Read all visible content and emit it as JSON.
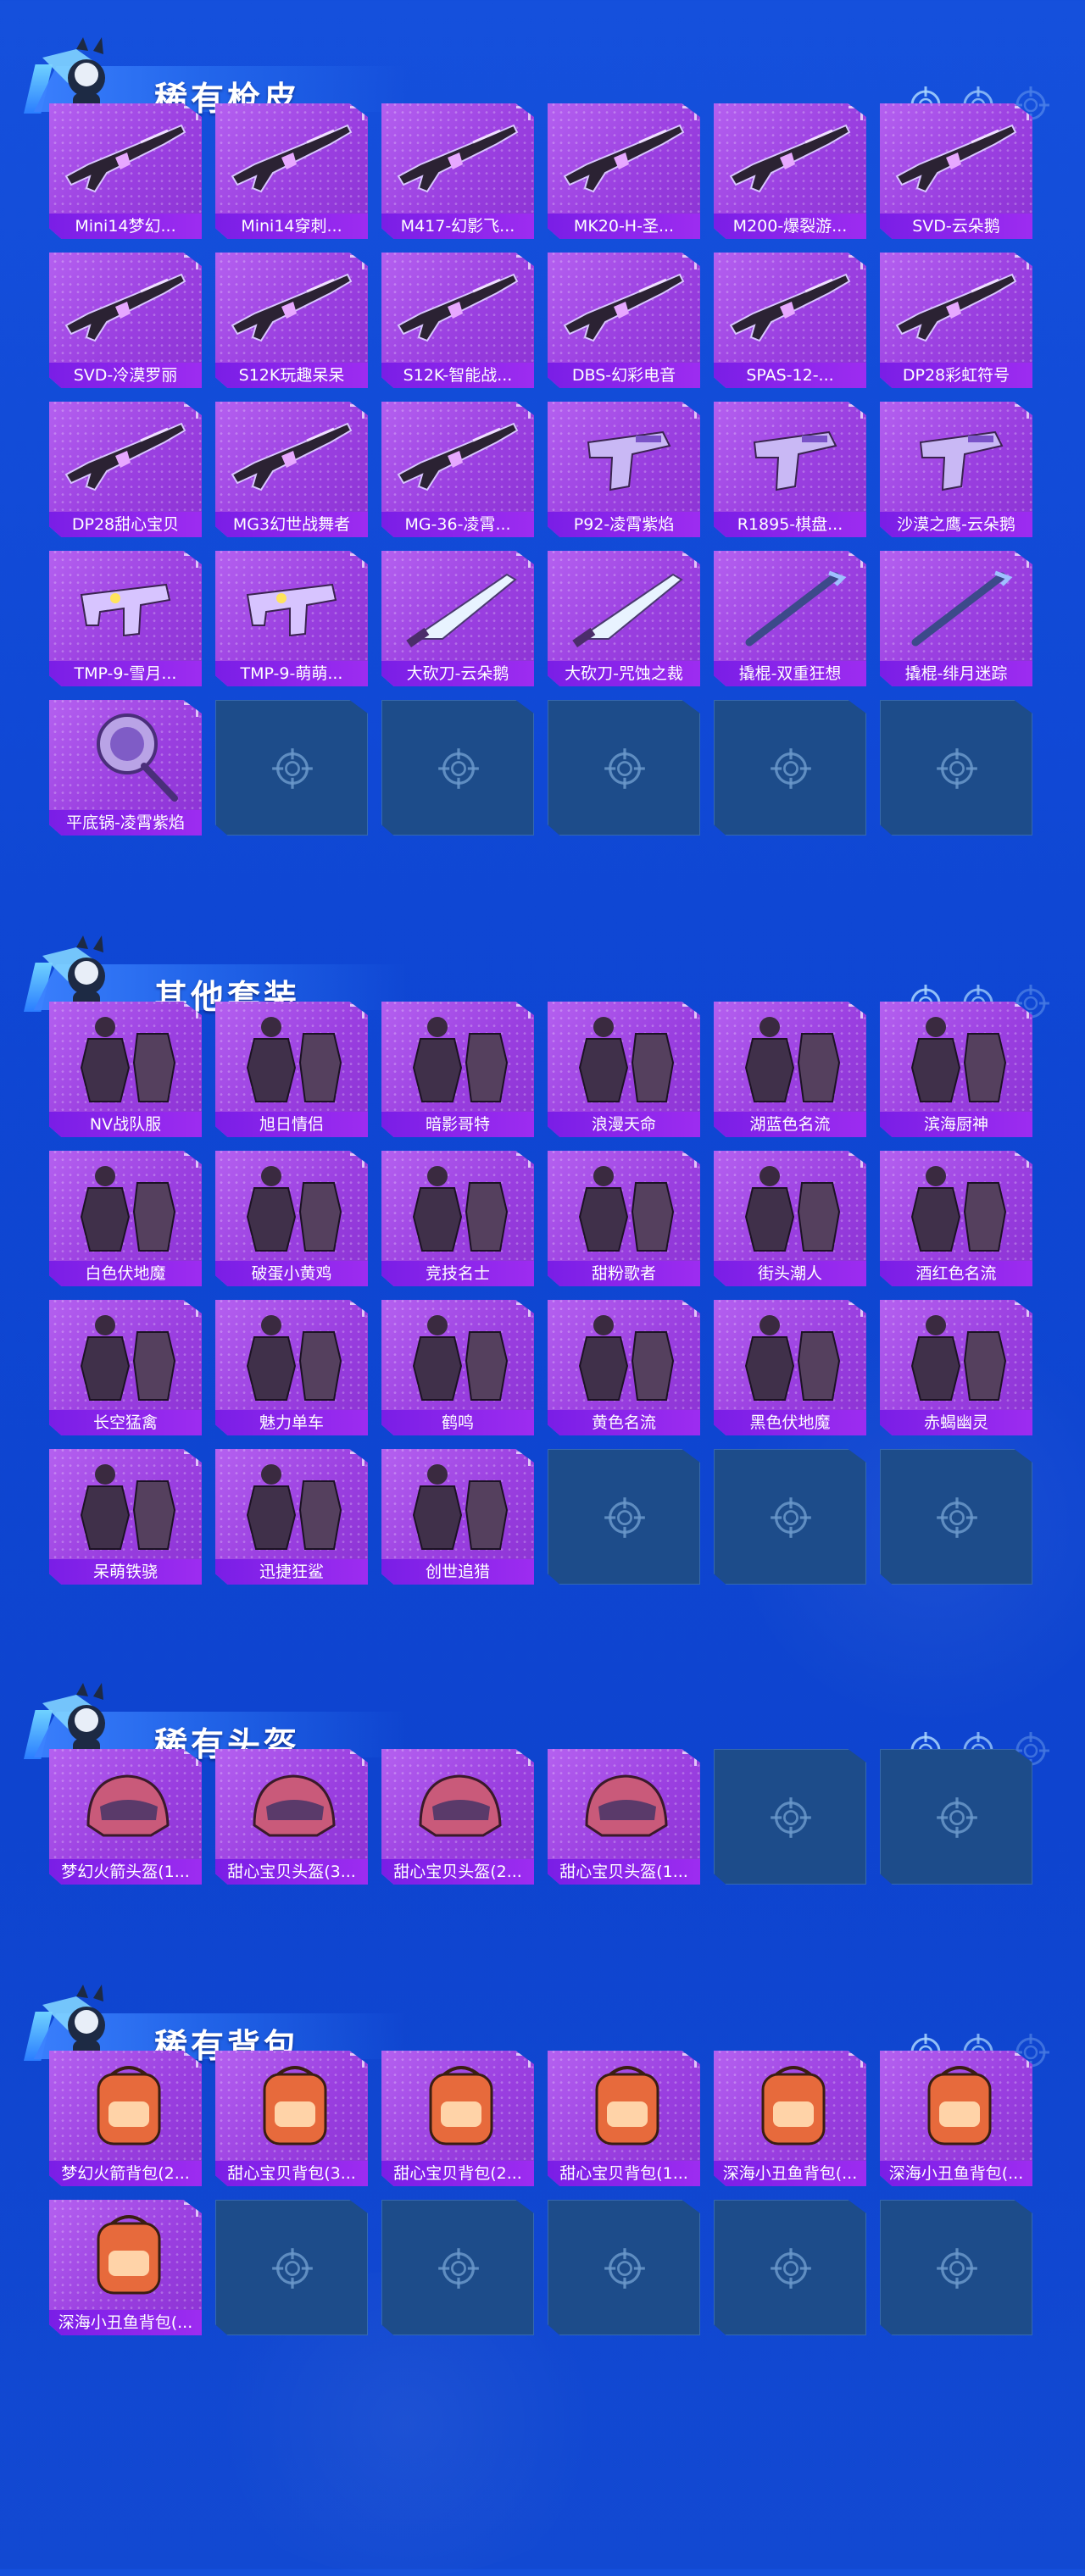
{
  "sections": [
    {
      "title": "稀有枪皮",
      "items": [
        {
          "label": "Mini14梦幻...",
          "art": "rifle"
        },
        {
          "label": "Mini14穿刺...",
          "art": "rifle"
        },
        {
          "label": "M417-幻影飞...",
          "art": "rifle"
        },
        {
          "label": "MK20-H-圣...",
          "art": "rifle"
        },
        {
          "label": "M200-爆裂游...",
          "art": "rifle"
        },
        {
          "label": "SVD-云朵鹅",
          "art": "rifle"
        },
        {
          "label": "SVD-冷漠罗丽",
          "art": "rifle"
        },
        {
          "label": "S12K玩趣呆呆",
          "art": "rifle"
        },
        {
          "label": "S12K-智能战...",
          "art": "rifle"
        },
        {
          "label": "DBS-幻彩电音",
          "art": "rifle"
        },
        {
          "label": "SPAS-12-...",
          "art": "rifle"
        },
        {
          "label": "DP28彩虹符号",
          "art": "rifle"
        },
        {
          "label": "DP28甜心宝贝",
          "art": "rifle"
        },
        {
          "label": "MG3幻世战舞者",
          "art": "rifle"
        },
        {
          "label": "MG-36-凌霄...",
          "art": "rifle"
        },
        {
          "label": "P92-凌霄紫焰",
          "art": "pistol"
        },
        {
          "label": "R1895-棋盘...",
          "art": "pistol"
        },
        {
          "label": "沙漠之鹰-云朵鹅",
          "art": "pistol"
        },
        {
          "label": "TMP-9-雪月...",
          "art": "smg"
        },
        {
          "label": "TMP-9-萌萌...",
          "art": "smg"
        },
        {
          "label": "大砍刀-云朵鹅",
          "art": "blade"
        },
        {
          "label": "大砍刀-咒蚀之裁",
          "art": "blade"
        },
        {
          "label": "撬棍-双重狂想",
          "art": "bar"
        },
        {
          "label": "撬棍-绯月迷踪",
          "art": "bar"
        },
        {
          "label": "平底锅-凌霄紫焰",
          "art": "pan"
        }
      ],
      "empty_slots": 5
    },
    {
      "title": "其他套装",
      "items": [
        {
          "label": "NV战队服",
          "art": "suit"
        },
        {
          "label": "旭日情侣",
          "art": "suit"
        },
        {
          "label": "暗影哥特",
          "art": "suit"
        },
        {
          "label": "浪漫天命",
          "art": "suit"
        },
        {
          "label": "湖蓝色名流",
          "art": "suit"
        },
        {
          "label": "滨海厨神",
          "art": "suit"
        },
        {
          "label": "白色伏地魔",
          "art": "suit"
        },
        {
          "label": "破蛋小黄鸡",
          "art": "suit"
        },
        {
          "label": "竞技名士",
          "art": "suit"
        },
        {
          "label": "甜粉歌者",
          "art": "suit"
        },
        {
          "label": "街头潮人",
          "art": "suit"
        },
        {
          "label": "酒红色名流",
          "art": "suit"
        },
        {
          "label": "长空猛禽",
          "art": "suit"
        },
        {
          "label": "魅力单车",
          "art": "suit"
        },
        {
          "label": "鹤鸣",
          "art": "suit"
        },
        {
          "label": "黄色名流",
          "art": "suit"
        },
        {
          "label": "黑色伏地魔",
          "art": "suit"
        },
        {
          "label": "赤蝎幽灵",
          "art": "suit"
        },
        {
          "label": "呆萌铁骁",
          "art": "suit"
        },
        {
          "label": "迅捷狂鲨",
          "art": "suit"
        },
        {
          "label": "创世追猎",
          "art": "suit"
        }
      ],
      "empty_slots": 3
    },
    {
      "title": "稀有头盔",
      "items": [
        {
          "label": "梦幻火箭头盔(1...",
          "art": "helmet"
        },
        {
          "label": "甜心宝贝头盔(3...",
          "art": "helmet"
        },
        {
          "label": "甜心宝贝头盔(2...",
          "art": "helmet"
        },
        {
          "label": "甜心宝贝头盔(1...",
          "art": "helmet"
        }
      ],
      "empty_slots": 2
    },
    {
      "title": "稀有背包",
      "items": [
        {
          "label": "梦幻火箭背包(2...",
          "art": "backpack"
        },
        {
          "label": "甜心宝贝背包(3...",
          "art": "backpack"
        },
        {
          "label": "甜心宝贝背包(2...",
          "art": "backpack"
        },
        {
          "label": "甜心宝贝背包(1...",
          "art": "backpack"
        },
        {
          "label": "深海小丑鱼背包(...",
          "art": "backpack"
        },
        {
          "label": "深海小丑鱼背包(...",
          "art": "backpack"
        },
        {
          "label": "深海小丑鱼背包(...",
          "art": "backpack"
        }
      ],
      "empty_slots": 5
    }
  ],
  "colors": {
    "card": "#a64ce8",
    "label_bar": "#8a24ec",
    "empty": "#1d4c8a",
    "background": "#1250d8"
  }
}
